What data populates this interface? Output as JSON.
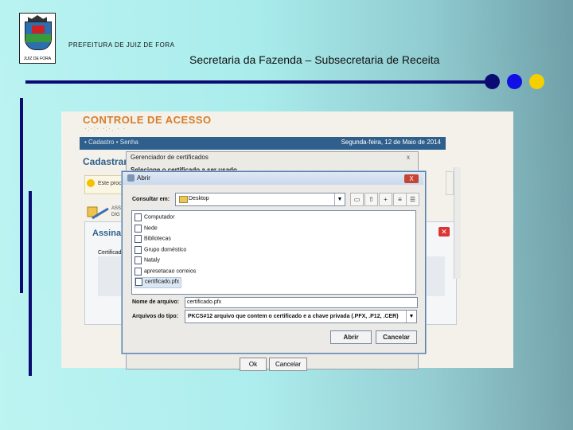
{
  "header": {
    "org": "PREFEITURA DE JUIZ DE FORA",
    "subtitle": "Secretaria da Fazenda – Subsecretaria de Receita",
    "crest_motto": "JUIZ DE FORA"
  },
  "colors": {
    "line": "#0b0b73",
    "dot_dark_blue": "#0b0b73",
    "dot_blue": "#1010e6",
    "dot_yellow": "#f5d000",
    "app_nav": "#2f5f8c",
    "app_title": "#d77d2a"
  },
  "app": {
    "title": "CONTROLE DE ACESSO",
    "tagline": "·:·:· ·:·. · ·",
    "nav": "• Cadastro  • Senha",
    "date": "Segunda-feira, 12 de Maio de 2014",
    "page_heading": "Cadastrar",
    "notice": "Este proc",
    "side_text": [
      "ASS",
      "DIG"
    ],
    "signature_panel_title": "Assinatu",
    "signature_cert_label": "Certificad",
    "close_icon": "close-icon"
  },
  "cert_manager": {
    "title": "Gerenciador de certificados",
    "close": "x",
    "prompt": "Selecione o certificado a ser usado",
    "ok_label": "Ok",
    "cancel_label": "Cancelar"
  },
  "open_dialog": {
    "title": "Abrir",
    "close": "X",
    "look_in_label": "Consultar em:",
    "look_in_value": "Desktop",
    "toolbar_icons": [
      "folder-icon",
      "up-folder-icon",
      "new-folder-icon",
      "list-view-icon",
      "details-view-icon"
    ],
    "files": [
      {
        "name": "Computador",
        "selected": false
      },
      {
        "name": "Nede",
        "selected": false
      },
      {
        "name": "Bibliotecas",
        "selected": false
      },
      {
        "name": "Grupo doméstico",
        "selected": false
      },
      {
        "name": "Nataly",
        "selected": false
      },
      {
        "name": "apresetacao correios",
        "selected": false
      },
      {
        "name": "certificado.pfx",
        "selected": true
      }
    ],
    "file_name_label": "Nome de arquivo:",
    "file_name_value": "certificado.pfx",
    "file_type_label": "Arquivos do tipo:",
    "file_type_value": "PKCS#12 arquivo que contem o certificado e a chave privada (.PFX, .P12, .CER)",
    "open_label": "Abrir",
    "cancel_label": "Cancelar"
  }
}
